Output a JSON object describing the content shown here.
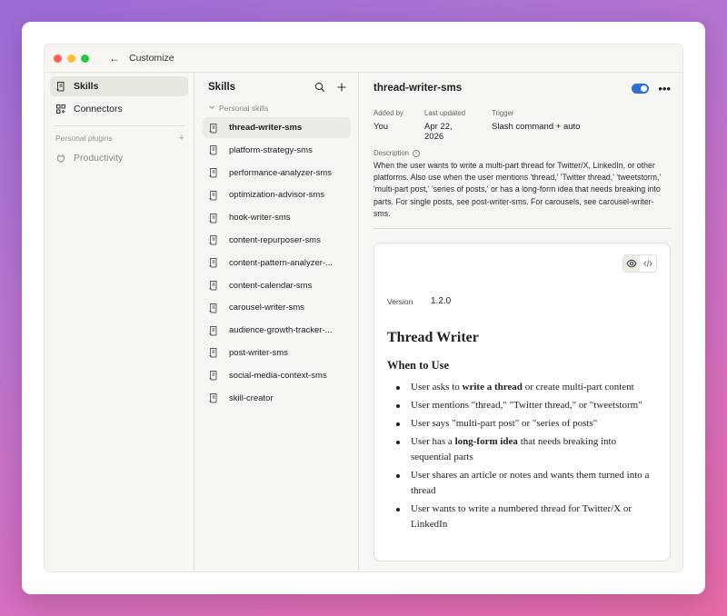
{
  "window": {
    "back_glyph": "←",
    "title": "Customize"
  },
  "nav": {
    "items": [
      {
        "label": "Skills",
        "icon": "scroll-icon"
      },
      {
        "label": "Connectors",
        "icon": "connectors-icon"
      }
    ],
    "plugins_header": "Personal plugins",
    "plugins_add": "+",
    "plugins": [
      {
        "label": "Productivity",
        "icon": "plugin-icon"
      }
    ]
  },
  "skills": {
    "title": "Skills",
    "group_label": "Personal skills",
    "items": [
      "thread-writer-sms",
      "platform-strategy-sms",
      "performance-analyzer-sms",
      "optimization-advisor-sms",
      "hook-writer-sms",
      "content-repurposer-sms",
      "content-pattern-analyzer-...",
      "content-calendar-sms",
      "carousel-writer-sms",
      "audience-growth-tracker-...",
      "post-writer-sms",
      "social-media-context-sms",
      "skill-creator"
    ]
  },
  "detail": {
    "title": "thread-writer-sms",
    "enabled": true,
    "more": "•••",
    "meta": [
      {
        "label": "Added by",
        "value": "You"
      },
      {
        "label": "Last updated",
        "value": "Apr 22, 2026"
      },
      {
        "label": "Trigger",
        "value": "Slash command + auto"
      }
    ],
    "description_label": "Description",
    "description": "When the user wants to write a multi-part thread for Twitter/X, LinkedIn, or other platforms. Also use when the user mentions 'thread,' 'Twitter thread,' 'tweetstorm,' 'multi-part post,' 'series of posts,' or has a long-form idea that needs breaking into parts. For single posts, see post-writer-sms. For carousels, see carousel-writer-sms.",
    "version_label": "Version",
    "version": "1.2.0",
    "doc": {
      "h1": "Thread Writer",
      "h2": "When to Use",
      "bullets": [
        {
          "pre": "User asks to ",
          "bold": "write a thread",
          "post": " or create multi-part content"
        },
        {
          "pre": "User mentions \"thread,\" \"Twitter thread,\" or \"tweetstorm\"",
          "bold": "",
          "post": ""
        },
        {
          "pre": "User says \"multi-part post\" or \"series of posts\"",
          "bold": "",
          "post": ""
        },
        {
          "pre": "User has a ",
          "bold": "long-form idea",
          "post": " that needs breaking into sequential parts"
        },
        {
          "pre": "User shares an article or notes and wants them turned into a thread",
          "bold": "",
          "post": ""
        },
        {
          "pre": "User wants to write a numbered thread for Twitter/X or LinkedIn",
          "bold": "",
          "post": ""
        }
      ]
    }
  },
  "colors": {
    "toggle_on": "#2b6fd6",
    "dot_red": "#ff5f57",
    "dot_yellow": "#febc2e",
    "dot_green": "#28c840"
  }
}
